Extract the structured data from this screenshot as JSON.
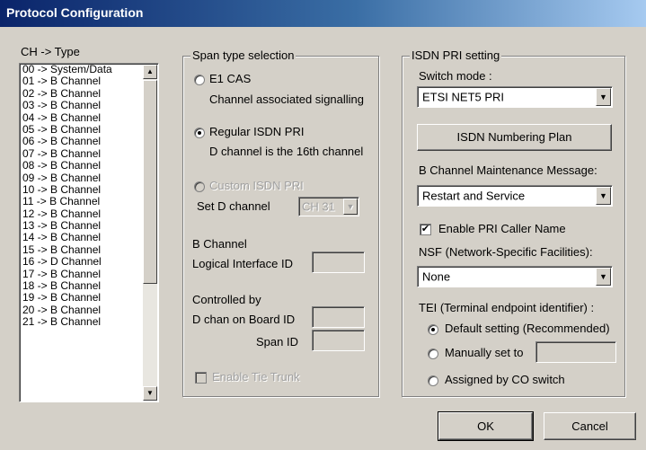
{
  "title": "Protocol Configuration",
  "channel_list": {
    "header": "CH   -> Type",
    "items": [
      "00 -> System/Data",
      "01 -> B Channel",
      "02 -> B Channel",
      "03 -> B Channel",
      "04 -> B Channel",
      "05 -> B Channel",
      "06 -> B Channel",
      "07 -> B Channel",
      "08 -> B Channel",
      "09 -> B Channel",
      "10 -> B Channel",
      "11 -> B Channel",
      "12 -> B Channel",
      "13 -> B Channel",
      "14 -> B Channel",
      "15 -> B Channel",
      "16 -> D Channel",
      "17 -> B Channel",
      "18 -> B Channel",
      "19 -> B Channel",
      "20 -> B Channel",
      "21 -> B Channel"
    ]
  },
  "span": {
    "title": "Span type selection",
    "e1_cas": "E1 CAS",
    "e1_cas_desc": "Channel associated signalling",
    "regular_isdn": "Regular ISDN PRI",
    "regular_isdn_desc": "D channel is the 16th channel",
    "custom_isdn": "Custom ISDN PRI",
    "set_d_channel": "Set D channel",
    "d_channel_value": "CH 31",
    "b_channel": "B Channel",
    "logical_interface": "Logical Interface ID",
    "controlled_by": "Controlled by",
    "d_chan_board": "D chan on Board ID",
    "span_id": "Span ID",
    "enable_tie_trunk": "Enable Tie Trunk"
  },
  "isdn": {
    "title": "ISDN PRI setting",
    "switch_mode_label": "Switch mode :",
    "switch_mode_value": "ETSI NET5 PRI",
    "numbering_plan_button": "ISDN Numbering Plan",
    "b_maint_label": "B Channel Maintenance Message:",
    "b_maint_value": "Restart and Service",
    "enable_caller_name": "Enable PRI Caller Name",
    "nsf_label": "NSF (Network-Specific Facilities):",
    "nsf_value": "None",
    "tei_label": "TEI (Terminal endpoint identifier) :",
    "tei_default": "Default setting (Recommended)",
    "tei_manual": "Manually set to",
    "tei_co": "Assigned by CO switch"
  },
  "buttons": {
    "ok": "OK",
    "cancel": "Cancel"
  }
}
